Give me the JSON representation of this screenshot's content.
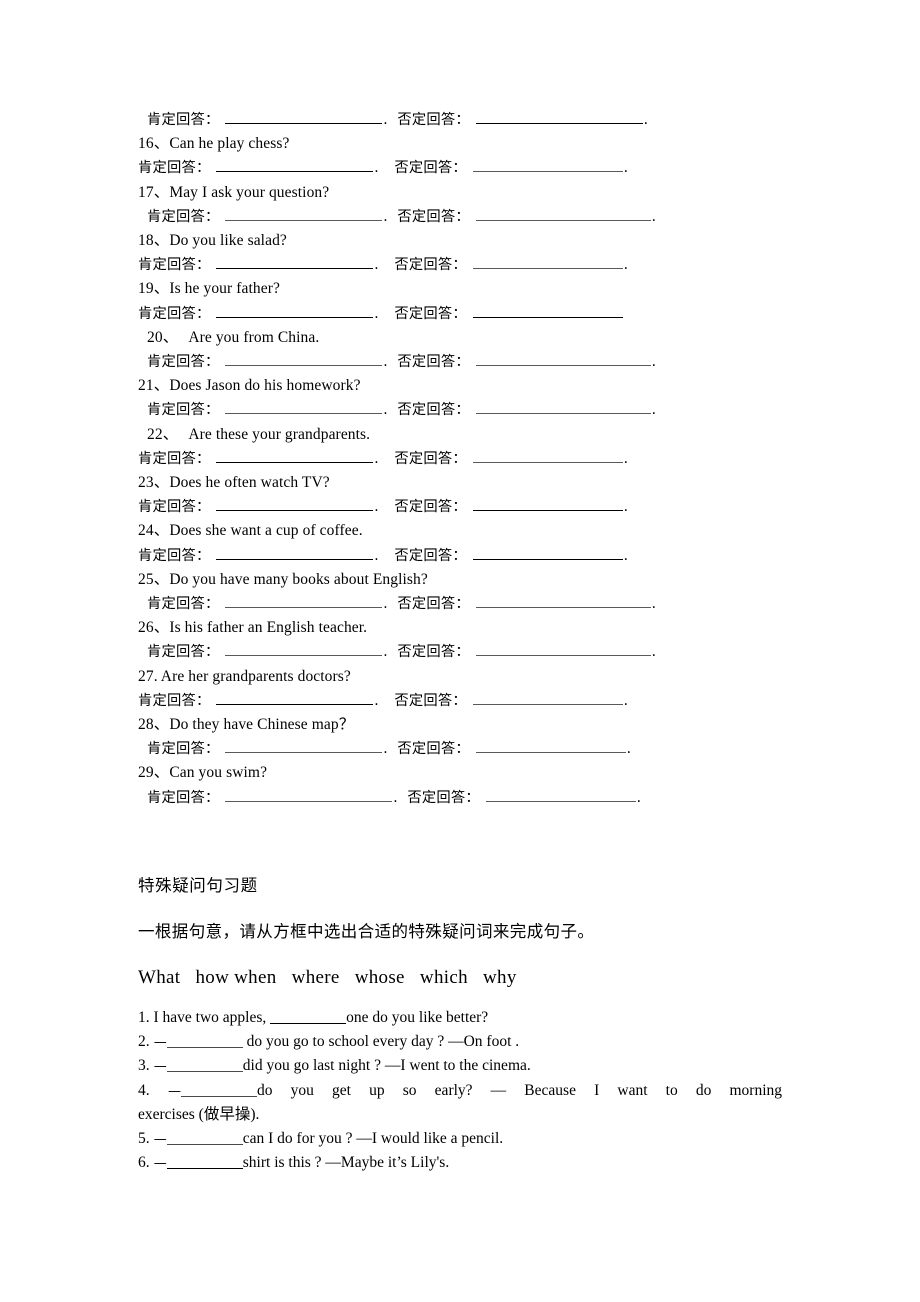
{
  "document": {
    "labels": {
      "affirmative": "肯定回答：",
      "negative": "否定回答：",
      "period": "."
    },
    "yes_no_items": [
      {
        "number": "",
        "text": "",
        "question_indent": false,
        "answer_indent": true
      },
      {
        "number": "16、",
        "text": "Can he play chess?",
        "question_indent": false,
        "answer_indent": false
      },
      {
        "number": "17、",
        "text": "May I ask your question?",
        "question_indent": false,
        "answer_indent": true
      },
      {
        "number": "18、",
        "text": "Do you like salad?",
        "question_indent": false,
        "answer_indent": false
      },
      {
        "number": "19、",
        "text": "Is he your father?",
        "question_indent": false,
        "answer_indent": false
      },
      {
        "number": "20、",
        "text": "Are you from China.",
        "question_indent": true,
        "answer_indent": true
      },
      {
        "number": "21、",
        "text": "Does Jason do his homework?",
        "question_indent": false,
        "answer_indent": true
      },
      {
        "number": "22、",
        "text": "Are these your grandparents.",
        "question_indent": true,
        "answer_indent": false
      },
      {
        "number": "23、",
        "text": "Does he often watch TV?",
        "question_indent": false,
        "answer_indent": false
      },
      {
        "number": "24、",
        "text": "Does she want a cup of coffee.",
        "question_indent": false,
        "answer_indent": false
      },
      {
        "number": "25、",
        "text": "Do you have many books about English?",
        "question_indent": false,
        "answer_indent": true
      },
      {
        "number": "26、",
        "text": "Is his father an English teacher.",
        "question_indent": false,
        "answer_indent": true
      },
      {
        "number": "27. ",
        "text": "Are her grandparents doctors?",
        "question_indent": false,
        "answer_indent": false
      },
      {
        "number": "28、",
        "text": "Do they have Chinese map？",
        "question_indent": false,
        "answer_indent": true
      },
      {
        "number": "29、",
        "text": "Can you swim?",
        "question_indent": false,
        "answer_indent": true
      }
    ],
    "section2": {
      "title": "特殊疑问句习题",
      "instruction": "一根据句意，请从方框中选出合适的特殊疑问词来完成句子。",
      "word_bank": "What   how when   where   whose   which   why",
      "word_bank_items": [
        "What",
        "how",
        "when",
        "where",
        "whose",
        "which",
        "why"
      ],
      "exercises": [
        {
          "num": "1.",
          "pre": " I have two apples, ",
          "post": "one do you like better?"
        },
        {
          "num": "2.",
          "pre": " —",
          "post": " do you go to school every day ?   —On foot ."
        },
        {
          "num": "3.",
          "pre": " —",
          "post": "did you go last night ?   —I went to the cinema."
        },
        {
          "num": "4.",
          "pre": " —",
          "post": "do you get up so early?   — Because I want to do morning",
          "continuation": "exercises (做早操)."
        },
        {
          "num": "5.",
          "pre": " —",
          "post": "can I do for you ?   —I would like a pencil."
        },
        {
          "num": "6.",
          "pre": " —",
          "post": "shirt is this ? —Maybe it’s Lily's."
        }
      ]
    }
  }
}
